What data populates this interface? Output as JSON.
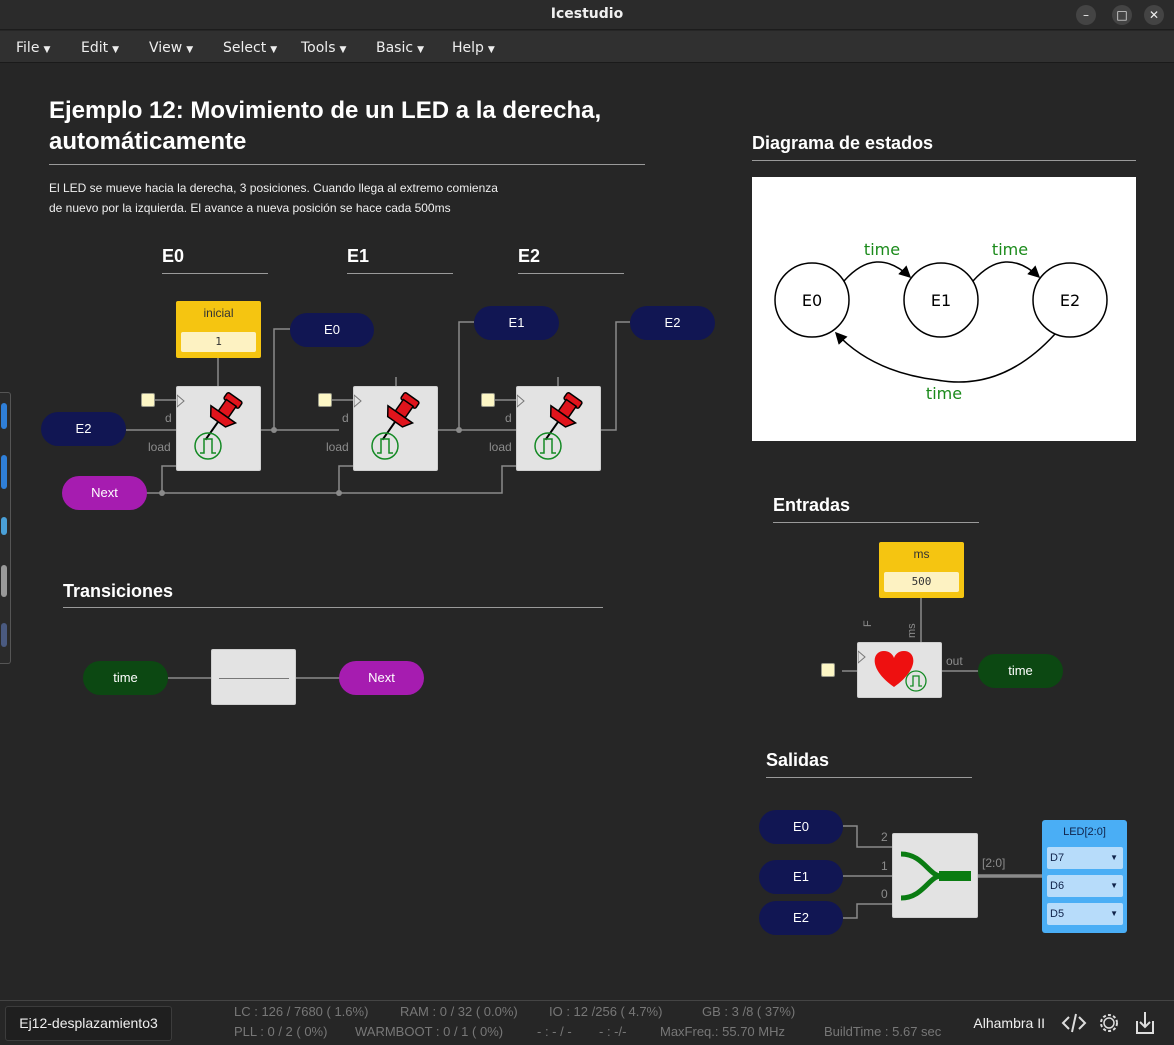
{
  "window": {
    "title": "Icestudio"
  },
  "menu": [
    "File",
    "Edit",
    "View",
    "Select",
    "Tools",
    "Basic",
    "Help"
  ],
  "doc": {
    "title_line1": "Ejemplo 12: Movimiento de un LED a la derecha,",
    "title_line2": "automáticamente",
    "desc_line1": "El LED se mueve hacia la derecha, 3 posiciones. Cuando llega al extremo comienza",
    "desc_line2": "de nuevo por la izquierda. El avance a nueva posición se hace cada 500ms"
  },
  "states": {
    "headers": [
      "E0",
      "E1",
      "E2"
    ],
    "initial_label": "inicial",
    "initial_value": "1",
    "input_e2": "E2",
    "input_next": "Next",
    "outputs": [
      "E0",
      "E1",
      "E2"
    ],
    "port_d": "d",
    "port_load": "load"
  },
  "transitions": {
    "heading": "Transiciones",
    "input": "time",
    "output": "Next"
  },
  "state_diagram": {
    "heading": "Diagrama de estados",
    "nodes": [
      "E0",
      "E1",
      "E2"
    ],
    "edge_label": "time"
  },
  "inputs_section": {
    "heading": "Entradas",
    "const_label": "ms",
    "const_value": "500",
    "port_F": "F",
    "port_ms": "ms",
    "port_out": "out",
    "output_label": "time"
  },
  "outputs_section": {
    "heading": "Salidas",
    "inputs": [
      "E0",
      "E1",
      "E2"
    ],
    "bit_labels": [
      "2",
      "1",
      "0"
    ],
    "bus_label": "[2:0]",
    "led_label": "LED[2:0]",
    "pins": [
      "D7",
      "D6",
      "D5"
    ]
  },
  "status": {
    "tab": "Ej12-desplazamiento3",
    "lc": "LC : 126 / 7680 ( 1.6%)",
    "ram": "RAM : 0 / 32 ( 0.0%)",
    "io": "IO : 12 /256 ( 4.7%)",
    "gb": "GB : 3 /8 ( 37%)",
    "pll": "PLL : 0 / 2 ( 0%)",
    "warmboot": "WARMBOOT : 0 / 1 ( 0%)",
    "dash1": "- : - / -",
    "dash2": "- : -/-",
    "maxfreq": "MaxFreq.: 55.70 MHz",
    "buildtime": "BuildTime : 5.67 sec",
    "board": "Alhambra II"
  },
  "colors": {
    "background": "#262626",
    "navy_label": "#111653",
    "purple_label": "#a61cb0",
    "green_label": "#0c4812",
    "constant": "#f5c511",
    "led_block": "#4aaef5"
  },
  "icons": [
    "minimize-icon",
    "maximize-icon",
    "close-icon",
    "pushpin-icon",
    "clock-pulse-icon",
    "heart-icon",
    "merge-icon",
    "verilog-code-icon",
    "settings-gear-icon",
    "upload-icon"
  ]
}
